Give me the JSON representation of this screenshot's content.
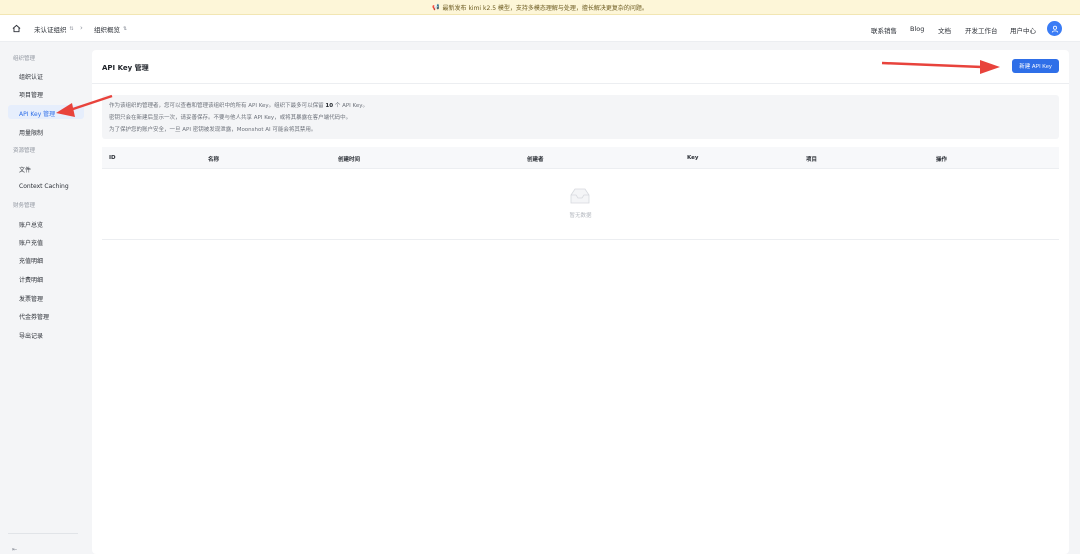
{
  "banner": {
    "icon": "megaphone-icon",
    "text": "最新发布 kimi k2.5 模型，支持多模态理解与处理，擅长解决更复杂的问题。"
  },
  "topnav": {
    "org_select": "未认证组织",
    "page_select": "组织概览",
    "links": [
      "联系销售",
      "Blog",
      "文档",
      "开发工作台",
      "用户中心"
    ]
  },
  "sidebar": {
    "groups": [
      {
        "label": "组织管理",
        "items": [
          "组织认证",
          "项目管理",
          "API Key 管理",
          "用量限制"
        ]
      },
      {
        "label": "资源管理",
        "items": [
          "文件",
          "Context Caching"
        ]
      },
      {
        "label": "财务管理",
        "items": [
          "账户总览",
          "账户充值",
          "充值明细",
          "计费明细",
          "发票管理",
          "代金券管理",
          "导出记录"
        ]
      }
    ],
    "active_item": "API Key 管理"
  },
  "main": {
    "title": "API Key 管理",
    "create_button": "新建 API Key",
    "notice": {
      "line1_prefix": "作为该组织的管理者，您可以查看和管理该组织中的所有 API Key。组织下最多可以保留 ",
      "line1_count": "10",
      "line1_suffix": " 个 API Key。",
      "line2": "密钥只会在新建后显示一次，请妥善保存。不要与他人共享 API Key，或将其暴露在客户端代码中。",
      "line3": "为了保护您的账户安全，一旦 API 密钥被发现泄露，Moonshot AI 可能会将其禁用。"
    },
    "table": {
      "columns": [
        "ID",
        "名称",
        "创建时间",
        "创建者",
        "Key",
        "项目",
        "操作"
      ],
      "rows": [],
      "empty_text": "暂无数据"
    }
  },
  "colors": {
    "accent": "#2f6fe8",
    "banner_bg": "#fdf6d8",
    "annotation_arrow": "#e8433c"
  }
}
